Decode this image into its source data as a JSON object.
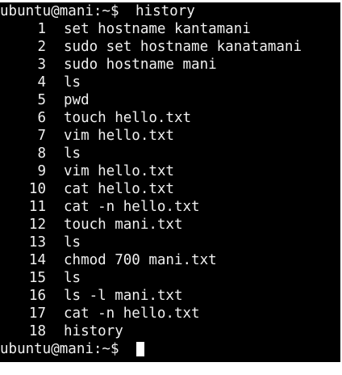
{
  "terminal": {
    "prompt": "ubuntu@mani:~$",
    "command": "history",
    "history": [
      {
        "num": "1",
        "cmd": "set hostname kantamani"
      },
      {
        "num": "2",
        "cmd": "sudo set hostname kanatamani"
      },
      {
        "num": "3",
        "cmd": "sudo hostname mani"
      },
      {
        "num": "4",
        "cmd": "ls"
      },
      {
        "num": "5",
        "cmd": "pwd"
      },
      {
        "num": "6",
        "cmd": "touch hello.txt"
      },
      {
        "num": "7",
        "cmd": "vim hello.txt"
      },
      {
        "num": "8",
        "cmd": "ls"
      },
      {
        "num": "9",
        "cmd": "vim hello.txt"
      },
      {
        "num": "10",
        "cmd": "cat hello.txt"
      },
      {
        "num": "11",
        "cmd": "cat -n hello.txt"
      },
      {
        "num": "12",
        "cmd": "touch mani.txt"
      },
      {
        "num": "13",
        "cmd": "ls"
      },
      {
        "num": "14",
        "cmd": "chmod 700 mani.txt"
      },
      {
        "num": "15",
        "cmd": "ls"
      },
      {
        "num": "16",
        "cmd": "ls -l mani.txt"
      },
      {
        "num": "17",
        "cmd": "cat -n hello.txt"
      },
      {
        "num": "18",
        "cmd": "history"
      }
    ],
    "final_prompt": "ubuntu@mani:~$",
    "colors": {
      "background": "#000000",
      "foreground": "#f0f0f0",
      "cursor": "#ffffff"
    }
  }
}
